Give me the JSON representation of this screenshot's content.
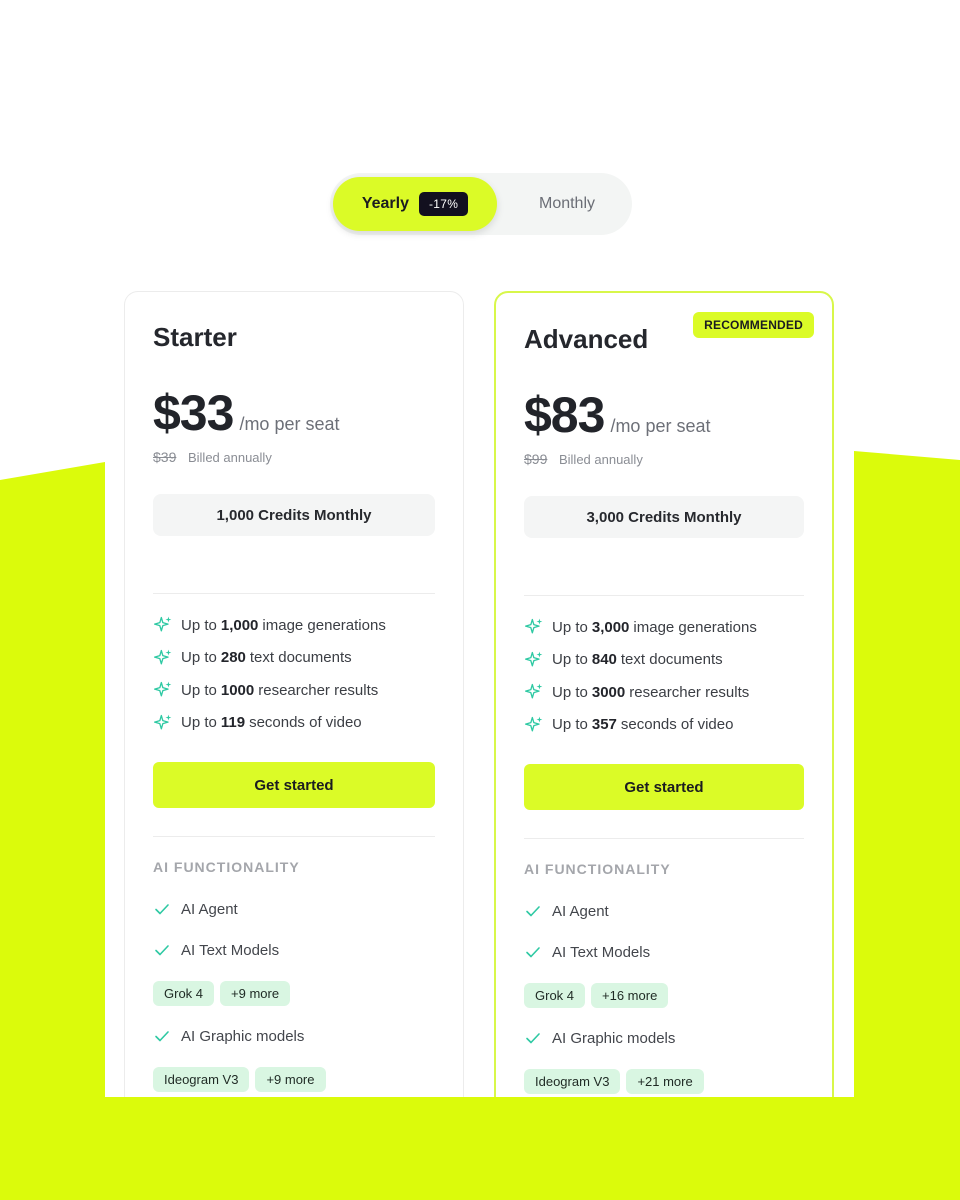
{
  "billing_toggle": {
    "yearly_label": "Yearly",
    "discount": "-17%",
    "monthly_label": "Monthly",
    "selected": "Yearly"
  },
  "plans": [
    {
      "name": "Starter",
      "price": "$33",
      "price_unit": "/mo per seat",
      "old_price": "$39",
      "billing_note": "Billed annually",
      "credits": "1,000 Credits Monthly",
      "limits": [
        {
          "prefix": "Up to",
          "value": "1,000",
          "suffix": "image generations"
        },
        {
          "prefix": "Up to",
          "value": "280",
          "suffix": "text documents"
        },
        {
          "prefix": "Up to",
          "value": "1000",
          "suffix": "researcher results"
        },
        {
          "prefix": "Up to",
          "value": "119",
          "suffix": "seconds of video"
        }
      ],
      "cta": "Get started",
      "section_title": "AI FUNCTIONALITY",
      "features": [
        "AI Agent",
        "AI Text Models",
        "AI Graphic models"
      ],
      "text_model_tags": [
        "Grok 4",
        "+9 more"
      ],
      "graphic_model_tags": [
        "Ideogram V3",
        "+9 more"
      ]
    },
    {
      "name": "Advanced",
      "badge": "RECOMMENDED",
      "price": "$83",
      "price_unit": "/mo per seat",
      "old_price": "$99",
      "billing_note": "Billed annually",
      "credits": "3,000 Credits Monthly",
      "limits": [
        {
          "prefix": "Up to",
          "value": "3,000",
          "suffix": "image generations"
        },
        {
          "prefix": "Up to",
          "value": "840",
          "suffix": "text documents"
        },
        {
          "prefix": "Up to",
          "value": "3000",
          "suffix": "researcher results"
        },
        {
          "prefix": "Up to",
          "value": "357",
          "suffix": "seconds of video"
        }
      ],
      "cta": "Get started",
      "section_title": "AI FUNCTIONALITY",
      "features": [
        "AI Agent",
        "AI Text Models",
        "AI Graphic models"
      ],
      "text_model_tags": [
        "Grok 4",
        "+16 more"
      ],
      "graphic_model_tags": [
        "Ideogram V3",
        "+21 more"
      ]
    }
  ],
  "colors": {
    "accent_lime": "#dbfb27",
    "badge_dark": "#12101f",
    "check_teal": "#2ec9a3",
    "tag_bg": "#d9f6e2"
  },
  "icons": {
    "limit_icon": "sparkle-icon",
    "feature_icon": "check-icon"
  }
}
